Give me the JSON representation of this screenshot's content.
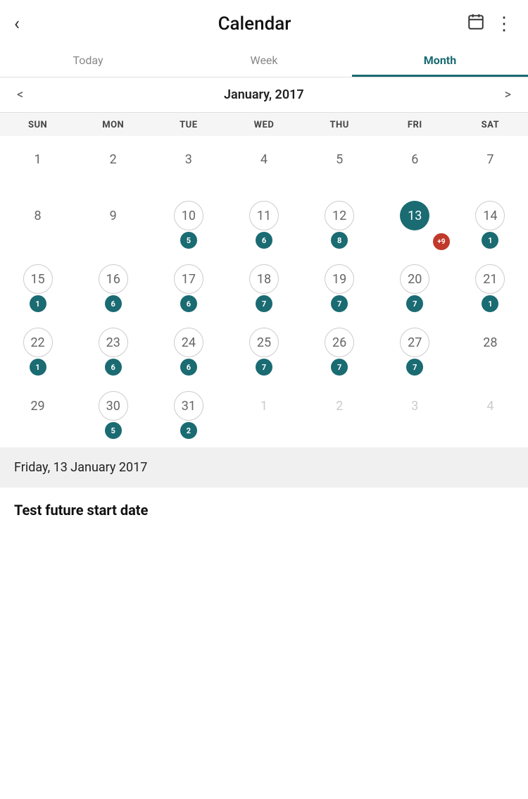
{
  "header": {
    "back_label": "‹",
    "title": "Calendar",
    "calendar_icon": "calendar-icon",
    "more_icon": "more-icon"
  },
  "tabs": [
    {
      "id": "today",
      "label": "Today",
      "active": false
    },
    {
      "id": "week",
      "label": "Week",
      "active": false
    },
    {
      "id": "month",
      "label": "Month",
      "active": true
    }
  ],
  "month_nav": {
    "prev_arrow": "<",
    "next_arrow": ">",
    "title": "January, 2017"
  },
  "day_headers": [
    "SUN",
    "MON",
    "TUE",
    "WED",
    "THU",
    "FRI",
    "SAT"
  ],
  "calendar": {
    "weeks": [
      [
        {
          "day": "1",
          "other": false,
          "ring": false,
          "today": false,
          "badge": null,
          "red_badge": null
        },
        {
          "day": "2",
          "other": false,
          "ring": false,
          "today": false,
          "badge": null,
          "red_badge": null
        },
        {
          "day": "3",
          "other": false,
          "ring": false,
          "today": false,
          "badge": null,
          "red_badge": null
        },
        {
          "day": "4",
          "other": false,
          "ring": false,
          "today": false,
          "badge": null,
          "red_badge": null
        },
        {
          "day": "5",
          "other": false,
          "ring": false,
          "today": false,
          "badge": null,
          "red_badge": null
        },
        {
          "day": "6",
          "other": false,
          "ring": false,
          "today": false,
          "badge": null,
          "red_badge": null
        },
        {
          "day": "7",
          "other": false,
          "ring": false,
          "today": false,
          "badge": null,
          "red_badge": null
        }
      ],
      [
        {
          "day": "8",
          "other": false,
          "ring": false,
          "today": false,
          "badge": null,
          "red_badge": null
        },
        {
          "day": "9",
          "other": false,
          "ring": false,
          "today": false,
          "badge": null,
          "red_badge": null
        },
        {
          "day": "10",
          "other": false,
          "ring": true,
          "today": false,
          "badge": "5",
          "red_badge": null
        },
        {
          "day": "11",
          "other": false,
          "ring": true,
          "today": false,
          "badge": "6",
          "red_badge": null
        },
        {
          "day": "12",
          "other": false,
          "ring": true,
          "today": false,
          "badge": "8",
          "red_badge": null
        },
        {
          "day": "13",
          "other": false,
          "ring": false,
          "today": true,
          "badge": null,
          "red_badge": "+9"
        },
        {
          "day": "14",
          "other": false,
          "ring": true,
          "today": false,
          "badge": "1",
          "red_badge": null
        }
      ],
      [
        {
          "day": "15",
          "other": false,
          "ring": true,
          "today": false,
          "badge": "1",
          "red_badge": null
        },
        {
          "day": "16",
          "other": false,
          "ring": true,
          "today": false,
          "badge": "6",
          "red_badge": null
        },
        {
          "day": "17",
          "other": false,
          "ring": true,
          "today": false,
          "badge": "6",
          "red_badge": null
        },
        {
          "day": "18",
          "other": false,
          "ring": true,
          "today": false,
          "badge": "7",
          "red_badge": null
        },
        {
          "day": "19",
          "other": false,
          "ring": true,
          "today": false,
          "badge": "7",
          "red_badge": null
        },
        {
          "day": "20",
          "other": false,
          "ring": true,
          "today": false,
          "badge": "7",
          "red_badge": null
        },
        {
          "day": "21",
          "other": false,
          "ring": true,
          "today": false,
          "badge": "1",
          "red_badge": null
        }
      ],
      [
        {
          "day": "22",
          "other": false,
          "ring": true,
          "today": false,
          "badge": "1",
          "red_badge": null
        },
        {
          "day": "23",
          "other": false,
          "ring": true,
          "today": false,
          "badge": "6",
          "red_badge": null
        },
        {
          "day": "24",
          "other": false,
          "ring": true,
          "today": false,
          "badge": "6",
          "red_badge": null
        },
        {
          "day": "25",
          "other": false,
          "ring": true,
          "today": false,
          "badge": "7",
          "red_badge": null
        },
        {
          "day": "26",
          "other": false,
          "ring": true,
          "today": false,
          "badge": "7",
          "red_badge": null
        },
        {
          "day": "27",
          "other": false,
          "ring": true,
          "today": false,
          "badge": "7",
          "red_badge": null
        },
        {
          "day": "28",
          "other": false,
          "ring": false,
          "today": false,
          "badge": null,
          "red_badge": null
        }
      ],
      [
        {
          "day": "29",
          "other": false,
          "ring": false,
          "today": false,
          "badge": null,
          "red_badge": null
        },
        {
          "day": "30",
          "other": false,
          "ring": true,
          "today": false,
          "badge": "5",
          "red_badge": null
        },
        {
          "day": "31",
          "other": false,
          "ring": true,
          "today": false,
          "badge": "2",
          "red_badge": null
        },
        {
          "day": "1",
          "other": true,
          "ring": false,
          "today": false,
          "badge": null,
          "red_badge": null
        },
        {
          "day": "2",
          "other": true,
          "ring": false,
          "today": false,
          "badge": null,
          "red_badge": null
        },
        {
          "day": "3",
          "other": true,
          "ring": false,
          "today": false,
          "badge": null,
          "red_badge": null
        },
        {
          "day": "4",
          "other": true,
          "ring": false,
          "today": false,
          "badge": null,
          "red_badge": null
        }
      ]
    ]
  },
  "selected_date": "Friday, 13 January 2017",
  "event_title": "Test future start date"
}
